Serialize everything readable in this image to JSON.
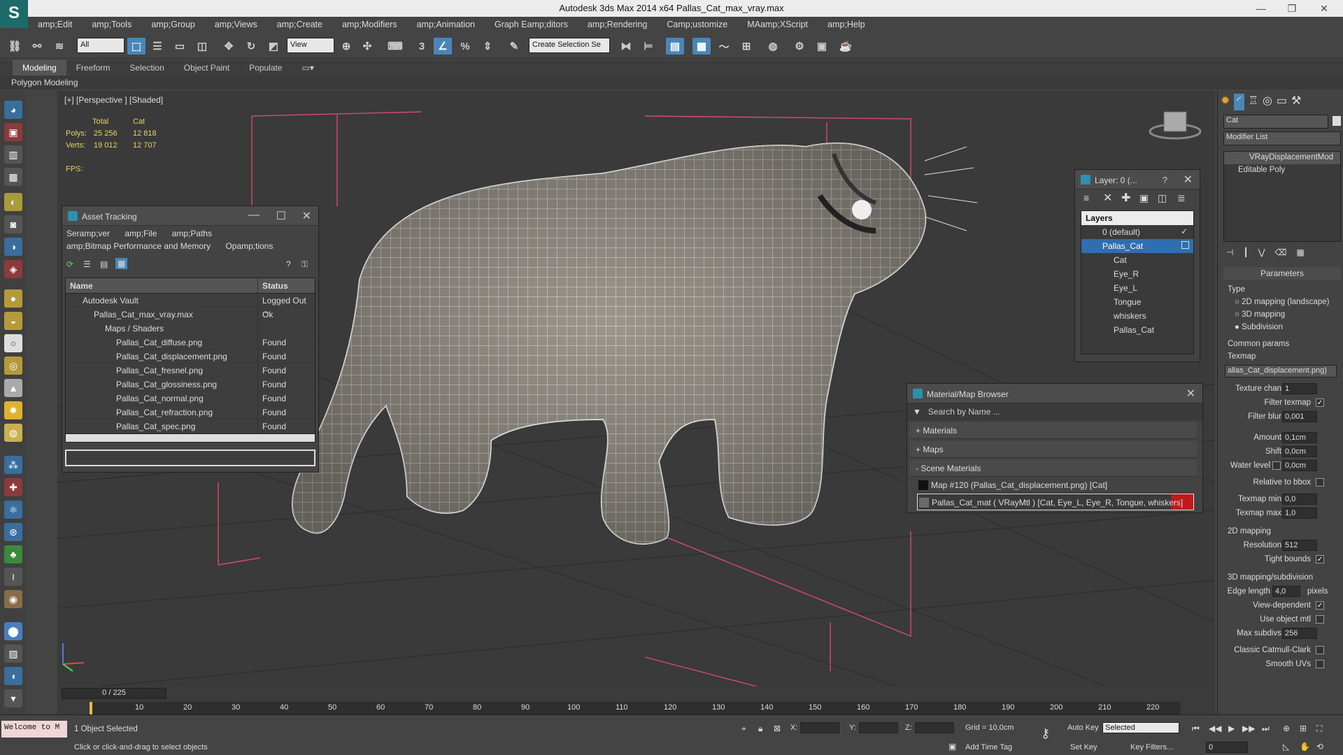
{
  "window": {
    "title": "Autodesk 3ds Max  2014 x64    Pallas_Cat_max_vray.max",
    "logo": "S"
  },
  "menu": [
    "amp;Edit",
    "amp;Tools",
    "amp;Group",
    "amp;Views",
    "amp;Create",
    "amp;Modifiers",
    "amp;Animation",
    "Graph Eamp;ditors",
    "amp;Rendering",
    "Camp;ustomize",
    "MAamp;XScript",
    "amp;Help"
  ],
  "toolbar": {
    "filter": "All",
    "refcoord": "View",
    "selset": "Create Selection Se",
    "snap3": "3",
    "snapangle": "∠",
    "snappercent": "%"
  },
  "ribbon": {
    "tabs": [
      "Modeling",
      "Freeform",
      "Selection",
      "Object Paint",
      "Populate"
    ],
    "sub": "Polygon Modeling"
  },
  "viewport": {
    "label": "[+] [Perspective ] [Shaded]",
    "stats": {
      "h_total": "Total",
      "h_cat": "Cat",
      "polys_label": "Polys:",
      "polys_total": "25 256",
      "polys_cat": "12 818",
      "verts_label": "Verts:",
      "verts_total": "19 012",
      "verts_cat": "12 707",
      "fps_label": "FPS:"
    }
  },
  "asset": {
    "title": "Asset Tracking",
    "menu1": [
      "Seramp;ver",
      "amp;File",
      "amp;Paths"
    ],
    "menu2": [
      "amp;Bitmap Performance and Memory",
      "Opamp;tions"
    ],
    "col_name": "Name",
    "col_status": "Status",
    "rows": [
      {
        "name": "Autodesk Vault",
        "status": "Logged Out ..."
      },
      {
        "name": "Pallas_Cat_max_vray.max",
        "status": "Ok"
      },
      {
        "name": "Maps / Shaders",
        "status": ""
      },
      {
        "name": "Pallas_Cat_diffuse.png",
        "status": "Found"
      },
      {
        "name": "Pallas_Cat_displacement.png",
        "status": "Found"
      },
      {
        "name": "Pallas_Cat_fresnel.png",
        "status": "Found"
      },
      {
        "name": "Pallas_Cat_glossiness.png",
        "status": "Found"
      },
      {
        "name": "Pallas_Cat_normal.png",
        "status": "Found"
      },
      {
        "name": "Pallas_Cat_refraction.png",
        "status": "Found"
      },
      {
        "name": "Pallas_Cat_spec.png",
        "status": "Found"
      }
    ]
  },
  "layer": {
    "title": "Layer: 0 (...",
    "help": "?",
    "header": "Layers",
    "items": [
      "0 (default)",
      "Pallas_Cat",
      "Cat",
      "Eye_R",
      "Eye_L",
      "Tongue",
      "whiskers",
      "Pallas_Cat"
    ]
  },
  "matbrowser": {
    "title": "Material/Map Browser",
    "search": "Search by Name ...",
    "materials": "+ Materials",
    "maps": "+ Maps",
    "scene": "- Scene Materials",
    "item1": "Map #120 (Pallas_Cat_displacement.png) [Cat]",
    "item2": "Pallas_Cat_mat  ( VRayMtl ) [Cat, Eye_L, Eye_R, Tongue, whiskers]"
  },
  "cmd": {
    "object_name": "Cat",
    "modifier_list": "Modifier List",
    "stack": [
      "VRayDisplacementMod",
      "Editable Poly"
    ],
    "rollout": "Parameters",
    "type_label": "Type",
    "type_opts": [
      "2D mapping (landscape)",
      "3D mapping",
      "Subdivision"
    ],
    "common": "Common params",
    "texmap": "Texmap",
    "texmap_val": "allas_Cat_displacement.png)",
    "fields": [
      {
        "label": "Texture chan",
        "val": "1"
      },
      {
        "label": "Filter texmap",
        "val": "✓"
      },
      {
        "label": "Filter blur",
        "val": "0,001"
      },
      {
        "label": "Amount",
        "val": "0,1cm"
      },
      {
        "label": "Shift",
        "val": "0,0cm"
      },
      {
        "label": "Water level",
        "val": "0,0cm"
      },
      {
        "label": "Relative to bbox",
        "val": ""
      },
      {
        "label": "Texmap min",
        "val": "0,0"
      },
      {
        "label": "Texmap max",
        "val": "1,0"
      }
    ],
    "map2d": "2D mapping",
    "resolution_label": "Resolution",
    "resolution": "512",
    "tight": "Tight bounds",
    "map3d": "3D mapping/subdivision",
    "edge_label": "Edge length",
    "edge": "4,0",
    "pixels": "pixels",
    "viewdep": "View-dependent",
    "useobj": "Use object mtl",
    "maxsub_label": "Max subdivs",
    "maxsub": "256",
    "catmull": "Classic Catmull-Clark",
    "smoothuv": "Smooth UVs"
  },
  "timeline": {
    "frame": "0 / 225",
    "ticks": [
      "10",
      "20",
      "30",
      "40",
      "50",
      "60",
      "70",
      "80",
      "90",
      "100",
      "110",
      "120",
      "130",
      "140",
      "150",
      "160",
      "170",
      "180",
      "190",
      "200",
      "210",
      "220"
    ]
  },
  "status": {
    "script": "Welcome to M",
    "selected": "1 Object Selected",
    "prompt": "Click or click-and-drag to select objects",
    "x": "X:",
    "y": "Y:",
    "z": "Z:",
    "grid": "Grid = 10,0cm",
    "addtime": "Add Time Tag",
    "autokey": "Auto Key",
    "setkey": "Set Key",
    "selmode": "Selected",
    "keyfilters": "Key Filters...",
    "frame_field": "0"
  },
  "colors": {
    "accent": "#4a86b8",
    "bg": "#444444",
    "stats": "#e6d16a"
  }
}
